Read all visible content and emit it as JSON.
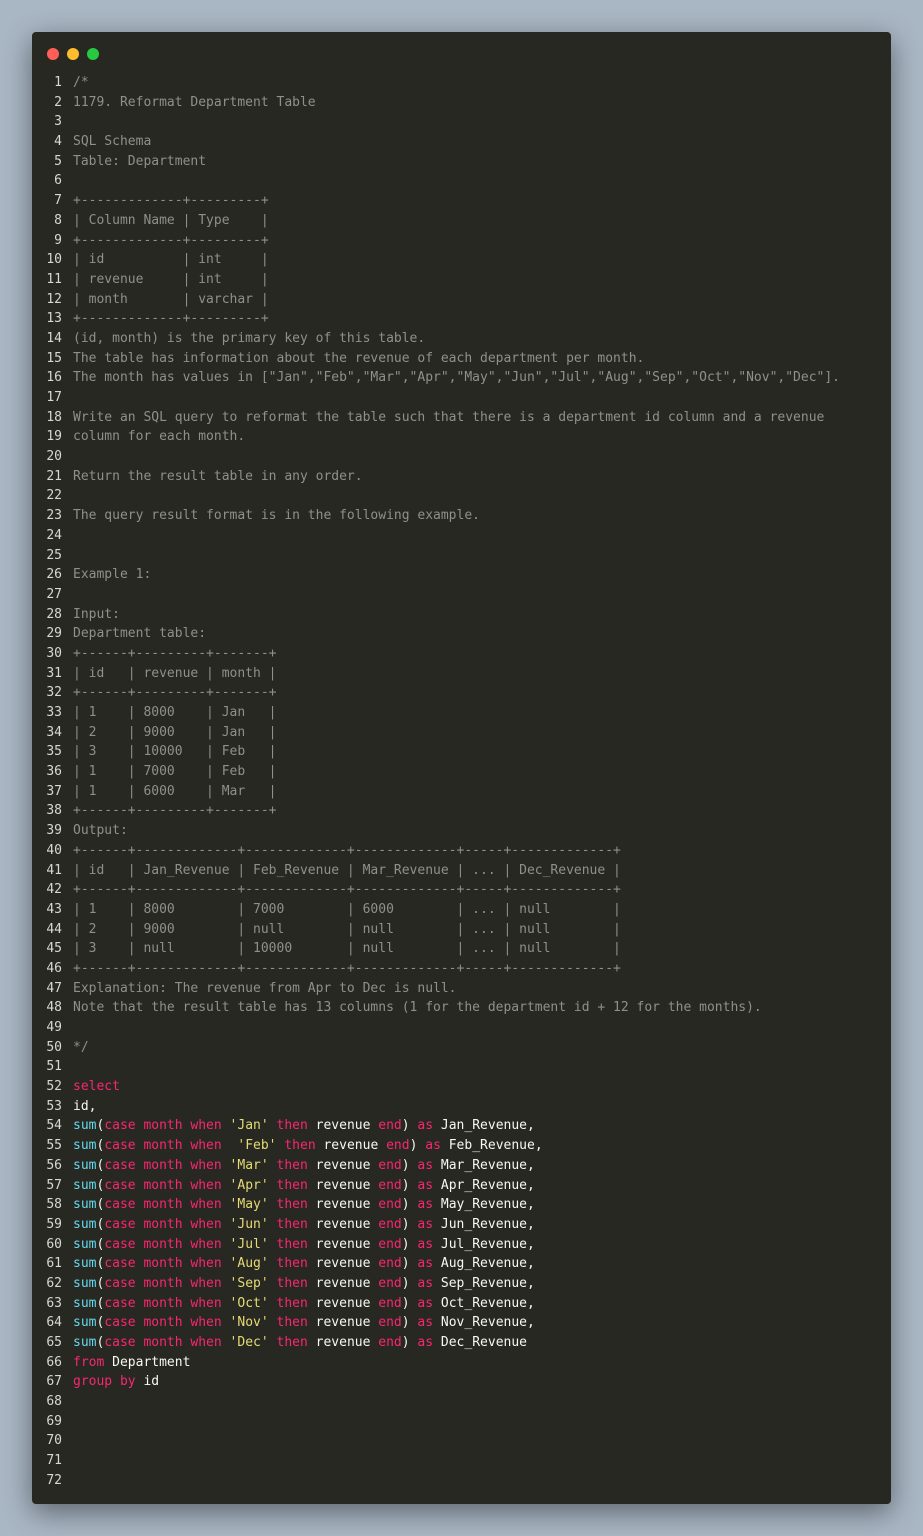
{
  "window": {
    "controls": [
      "close",
      "minimize",
      "maximize"
    ]
  },
  "colors": {
    "background": "#a9b6c4",
    "editor": "#272822",
    "comment": "#8f908a",
    "keyword": "#f92672",
    "function": "#66d9ef",
    "string": "#e6db74",
    "plain": "#f8f8f2",
    "line_number": "#d8d8d2"
  },
  "lines": [
    {
      "n": "1",
      "tokens": [
        {
          "t": "c",
          "v": "/*"
        }
      ]
    },
    {
      "n": "2",
      "tokens": [
        {
          "t": "c",
          "v": "1179. Reformat Department Table"
        }
      ]
    },
    {
      "n": "3",
      "tokens": []
    },
    {
      "n": "4",
      "tokens": [
        {
          "t": "c",
          "v": "SQL Schema"
        }
      ]
    },
    {
      "n": "5",
      "tokens": [
        {
          "t": "c",
          "v": "Table: Department"
        }
      ]
    },
    {
      "n": "6",
      "tokens": []
    },
    {
      "n": "7",
      "tokens": [
        {
          "t": "c",
          "v": "+-------------+---------+"
        }
      ]
    },
    {
      "n": "8",
      "tokens": [
        {
          "t": "c",
          "v": "| Column Name | Type    |"
        }
      ]
    },
    {
      "n": "9",
      "tokens": [
        {
          "t": "c",
          "v": "+-------------+---------+"
        }
      ]
    },
    {
      "n": "10",
      "tokens": [
        {
          "t": "c",
          "v": "| id          | int     |"
        }
      ]
    },
    {
      "n": "11",
      "tokens": [
        {
          "t": "c",
          "v": "| revenue     | int     |"
        }
      ]
    },
    {
      "n": "12",
      "tokens": [
        {
          "t": "c",
          "v": "| month       | varchar |"
        }
      ]
    },
    {
      "n": "13",
      "tokens": [
        {
          "t": "c",
          "v": "+-------------+---------+"
        }
      ]
    },
    {
      "n": "14",
      "tokens": [
        {
          "t": "c",
          "v": "(id, month) is the primary key of this table."
        }
      ]
    },
    {
      "n": "15",
      "tokens": [
        {
          "t": "c",
          "v": "The table has information about the revenue of each department per month."
        }
      ]
    },
    {
      "n": "16",
      "tokens": [
        {
          "t": "c",
          "v": "The month has values in [\"Jan\",\"Feb\",\"Mar\",\"Apr\",\"May\",\"Jun\",\"Jul\",\"Aug\",\"Sep\",\"Oct\",\"Nov\",\"Dec\"]."
        }
      ]
    },
    {
      "n": "17",
      "tokens": []
    },
    {
      "n": "18",
      "tokens": [
        {
          "t": "c",
          "v": "Write an SQL query to reformat the table such that there is a department id column and a revenue"
        }
      ]
    },
    {
      "n": "19",
      "tokens": [
        {
          "t": "c",
          "v": "column for each month."
        }
      ]
    },
    {
      "n": "20",
      "tokens": []
    },
    {
      "n": "21",
      "tokens": [
        {
          "t": "c",
          "v": "Return the result table in any order."
        }
      ]
    },
    {
      "n": "22",
      "tokens": []
    },
    {
      "n": "23",
      "tokens": [
        {
          "t": "c",
          "v": "The query result format is in the following example."
        }
      ]
    },
    {
      "n": "24",
      "tokens": []
    },
    {
      "n": "25",
      "tokens": []
    },
    {
      "n": "26",
      "tokens": [
        {
          "t": "c",
          "v": "Example 1:"
        }
      ]
    },
    {
      "n": "27",
      "tokens": []
    },
    {
      "n": "28",
      "tokens": [
        {
          "t": "c",
          "v": "Input:"
        }
      ]
    },
    {
      "n": "29",
      "tokens": [
        {
          "t": "c",
          "v": "Department table:"
        }
      ]
    },
    {
      "n": "30",
      "tokens": [
        {
          "t": "c",
          "v": "+------+---------+-------+"
        }
      ]
    },
    {
      "n": "31",
      "tokens": [
        {
          "t": "c",
          "v": "| id   | revenue | month |"
        }
      ]
    },
    {
      "n": "32",
      "tokens": [
        {
          "t": "c",
          "v": "+------+---------+-------+"
        }
      ]
    },
    {
      "n": "33",
      "tokens": [
        {
          "t": "c",
          "v": "| 1    | 8000    | Jan   |"
        }
      ]
    },
    {
      "n": "34",
      "tokens": [
        {
          "t": "c",
          "v": "| 2    | 9000    | Jan   |"
        }
      ]
    },
    {
      "n": "35",
      "tokens": [
        {
          "t": "c",
          "v": "| 3    | 10000   | Feb   |"
        }
      ]
    },
    {
      "n": "36",
      "tokens": [
        {
          "t": "c",
          "v": "| 1    | 7000    | Feb   |"
        }
      ]
    },
    {
      "n": "37",
      "tokens": [
        {
          "t": "c",
          "v": "| 1    | 6000    | Mar   |"
        }
      ]
    },
    {
      "n": "38",
      "tokens": [
        {
          "t": "c",
          "v": "+------+---------+-------+"
        }
      ]
    },
    {
      "n": "39",
      "tokens": [
        {
          "t": "c",
          "v": "Output:"
        }
      ]
    },
    {
      "n": "40",
      "tokens": [
        {
          "t": "c",
          "v": "+------+-------------+-------------+-------------+-----+-------------+"
        }
      ]
    },
    {
      "n": "41",
      "tokens": [
        {
          "t": "c",
          "v": "| id   | Jan_Revenue | Feb_Revenue | Mar_Revenue | ... | Dec_Revenue |"
        }
      ]
    },
    {
      "n": "42",
      "tokens": [
        {
          "t": "c",
          "v": "+------+-------------+-------------+-------------+-----+-------------+"
        }
      ]
    },
    {
      "n": "43",
      "tokens": [
        {
          "t": "c",
          "v": "| 1    | 8000        | 7000        | 6000        | ... | null        |"
        }
      ]
    },
    {
      "n": "44",
      "tokens": [
        {
          "t": "c",
          "v": "| 2    | 9000        | null        | null        | ... | null        |"
        }
      ]
    },
    {
      "n": "45",
      "tokens": [
        {
          "t": "c",
          "v": "| 3    | null        | 10000       | null        | ... | null        |"
        }
      ]
    },
    {
      "n": "46",
      "tokens": [
        {
          "t": "c",
          "v": "+------+-------------+-------------+-------------+-----+-------------+"
        }
      ]
    },
    {
      "n": "47",
      "tokens": [
        {
          "t": "c",
          "v": "Explanation: The revenue from Apr to Dec is null."
        }
      ]
    },
    {
      "n": "48",
      "tokens": [
        {
          "t": "c",
          "v": "Note that the result table has 13 columns (1 for the department id + 12 for the months)."
        }
      ]
    },
    {
      "n": "49",
      "tokens": []
    },
    {
      "n": "50",
      "tokens": [
        {
          "t": "c",
          "v": "*/"
        }
      ]
    },
    {
      "n": "51",
      "tokens": []
    },
    {
      "n": "52",
      "tokens": [
        {
          "t": "k",
          "v": "select"
        }
      ]
    },
    {
      "n": "53",
      "tokens": [
        {
          "t": "p",
          "v": "id,"
        }
      ]
    },
    {
      "n": "54",
      "tokens": [
        {
          "t": "f",
          "v": "sum"
        },
        {
          "t": "p",
          "v": "("
        },
        {
          "t": "k",
          "v": "case month when "
        },
        {
          "t": "s",
          "v": "'Jan'"
        },
        {
          "t": "k",
          "v": " then "
        },
        {
          "t": "p",
          "v": "revenue "
        },
        {
          "t": "k",
          "v": "end"
        },
        {
          "t": "p",
          "v": ") "
        },
        {
          "t": "k",
          "v": "as "
        },
        {
          "t": "p",
          "v": "Jan_Revenue,"
        }
      ]
    },
    {
      "n": "55",
      "tokens": [
        {
          "t": "f",
          "v": "sum"
        },
        {
          "t": "p",
          "v": "("
        },
        {
          "t": "k",
          "v": "case month when "
        },
        {
          "t": "s",
          "v": " 'Feb'"
        },
        {
          "t": "k",
          "v": " then "
        },
        {
          "t": "p",
          "v": "revenue "
        },
        {
          "t": "k",
          "v": "end"
        },
        {
          "t": "p",
          "v": ") "
        },
        {
          "t": "k",
          "v": "as "
        },
        {
          "t": "p",
          "v": "Feb_Revenue,"
        }
      ]
    },
    {
      "n": "56",
      "tokens": [
        {
          "t": "f",
          "v": "sum"
        },
        {
          "t": "p",
          "v": "("
        },
        {
          "t": "k",
          "v": "case month when "
        },
        {
          "t": "s",
          "v": "'Mar'"
        },
        {
          "t": "k",
          "v": " then "
        },
        {
          "t": "p",
          "v": "revenue "
        },
        {
          "t": "k",
          "v": "end"
        },
        {
          "t": "p",
          "v": ") "
        },
        {
          "t": "k",
          "v": "as "
        },
        {
          "t": "p",
          "v": "Mar_Revenue,"
        }
      ]
    },
    {
      "n": "57",
      "tokens": [
        {
          "t": "f",
          "v": "sum"
        },
        {
          "t": "p",
          "v": "("
        },
        {
          "t": "k",
          "v": "case month when "
        },
        {
          "t": "s",
          "v": "'Apr'"
        },
        {
          "t": "k",
          "v": " then "
        },
        {
          "t": "p",
          "v": "revenue "
        },
        {
          "t": "k",
          "v": "end"
        },
        {
          "t": "p",
          "v": ") "
        },
        {
          "t": "k",
          "v": "as "
        },
        {
          "t": "p",
          "v": "Apr_Revenue,"
        }
      ]
    },
    {
      "n": "58",
      "tokens": [
        {
          "t": "f",
          "v": "sum"
        },
        {
          "t": "p",
          "v": "("
        },
        {
          "t": "k",
          "v": "case month when "
        },
        {
          "t": "s",
          "v": "'May'"
        },
        {
          "t": "k",
          "v": " then "
        },
        {
          "t": "p",
          "v": "revenue "
        },
        {
          "t": "k",
          "v": "end"
        },
        {
          "t": "p",
          "v": ") "
        },
        {
          "t": "k",
          "v": "as "
        },
        {
          "t": "p",
          "v": "May_Revenue,"
        }
      ]
    },
    {
      "n": "59",
      "tokens": [
        {
          "t": "f",
          "v": "sum"
        },
        {
          "t": "p",
          "v": "("
        },
        {
          "t": "k",
          "v": "case month when "
        },
        {
          "t": "s",
          "v": "'Jun'"
        },
        {
          "t": "k",
          "v": " then "
        },
        {
          "t": "p",
          "v": "revenue "
        },
        {
          "t": "k",
          "v": "end"
        },
        {
          "t": "p",
          "v": ") "
        },
        {
          "t": "k",
          "v": "as "
        },
        {
          "t": "p",
          "v": "Jun_Revenue,"
        }
      ]
    },
    {
      "n": "60",
      "tokens": [
        {
          "t": "f",
          "v": "sum"
        },
        {
          "t": "p",
          "v": "("
        },
        {
          "t": "k",
          "v": "case month when "
        },
        {
          "t": "s",
          "v": "'Jul'"
        },
        {
          "t": "k",
          "v": " then "
        },
        {
          "t": "p",
          "v": "revenue "
        },
        {
          "t": "k",
          "v": "end"
        },
        {
          "t": "p",
          "v": ") "
        },
        {
          "t": "k",
          "v": "as "
        },
        {
          "t": "p",
          "v": "Jul_Revenue,"
        }
      ]
    },
    {
      "n": "61",
      "tokens": [
        {
          "t": "f",
          "v": "sum"
        },
        {
          "t": "p",
          "v": "("
        },
        {
          "t": "k",
          "v": "case month when "
        },
        {
          "t": "s",
          "v": "'Aug'"
        },
        {
          "t": "k",
          "v": " then "
        },
        {
          "t": "p",
          "v": "revenue "
        },
        {
          "t": "k",
          "v": "end"
        },
        {
          "t": "p",
          "v": ") "
        },
        {
          "t": "k",
          "v": "as "
        },
        {
          "t": "p",
          "v": "Aug_Revenue,"
        }
      ]
    },
    {
      "n": "62",
      "tokens": [
        {
          "t": "f",
          "v": "sum"
        },
        {
          "t": "p",
          "v": "("
        },
        {
          "t": "k",
          "v": "case month when "
        },
        {
          "t": "s",
          "v": "'Sep'"
        },
        {
          "t": "k",
          "v": " then "
        },
        {
          "t": "p",
          "v": "revenue "
        },
        {
          "t": "k",
          "v": "end"
        },
        {
          "t": "p",
          "v": ") "
        },
        {
          "t": "k",
          "v": "as "
        },
        {
          "t": "p",
          "v": "Sep_Revenue,"
        }
      ]
    },
    {
      "n": "63",
      "tokens": [
        {
          "t": "f",
          "v": "sum"
        },
        {
          "t": "p",
          "v": "("
        },
        {
          "t": "k",
          "v": "case month when "
        },
        {
          "t": "s",
          "v": "'Oct'"
        },
        {
          "t": "k",
          "v": " then "
        },
        {
          "t": "p",
          "v": "revenue "
        },
        {
          "t": "k",
          "v": "end"
        },
        {
          "t": "p",
          "v": ") "
        },
        {
          "t": "k",
          "v": "as "
        },
        {
          "t": "p",
          "v": "Oct_Revenue,"
        }
      ]
    },
    {
      "n": "64",
      "tokens": [
        {
          "t": "f",
          "v": "sum"
        },
        {
          "t": "p",
          "v": "("
        },
        {
          "t": "k",
          "v": "case month when "
        },
        {
          "t": "s",
          "v": "'Nov'"
        },
        {
          "t": "k",
          "v": " then "
        },
        {
          "t": "p",
          "v": "revenue "
        },
        {
          "t": "k",
          "v": "end"
        },
        {
          "t": "p",
          "v": ") "
        },
        {
          "t": "k",
          "v": "as "
        },
        {
          "t": "p",
          "v": "Nov_Revenue,"
        }
      ]
    },
    {
      "n": "65",
      "tokens": [
        {
          "t": "f",
          "v": "sum"
        },
        {
          "t": "p",
          "v": "("
        },
        {
          "t": "k",
          "v": "case month when "
        },
        {
          "t": "s",
          "v": "'Dec'"
        },
        {
          "t": "k",
          "v": " then "
        },
        {
          "t": "p",
          "v": "revenue "
        },
        {
          "t": "k",
          "v": "end"
        },
        {
          "t": "p",
          "v": ") "
        },
        {
          "t": "k",
          "v": "as "
        },
        {
          "t": "p",
          "v": "Dec_Revenue"
        }
      ]
    },
    {
      "n": "66",
      "tokens": [
        {
          "t": "k",
          "v": "from "
        },
        {
          "t": "p",
          "v": "Department"
        }
      ]
    },
    {
      "n": "67",
      "tokens": [
        {
          "t": "k",
          "v": "group by "
        },
        {
          "t": "p",
          "v": "id"
        }
      ]
    },
    {
      "n": "68",
      "tokens": []
    },
    {
      "n": "69",
      "tokens": []
    },
    {
      "n": "70",
      "tokens": []
    },
    {
      "n": "71",
      "tokens": []
    },
    {
      "n": "72",
      "tokens": []
    }
  ]
}
